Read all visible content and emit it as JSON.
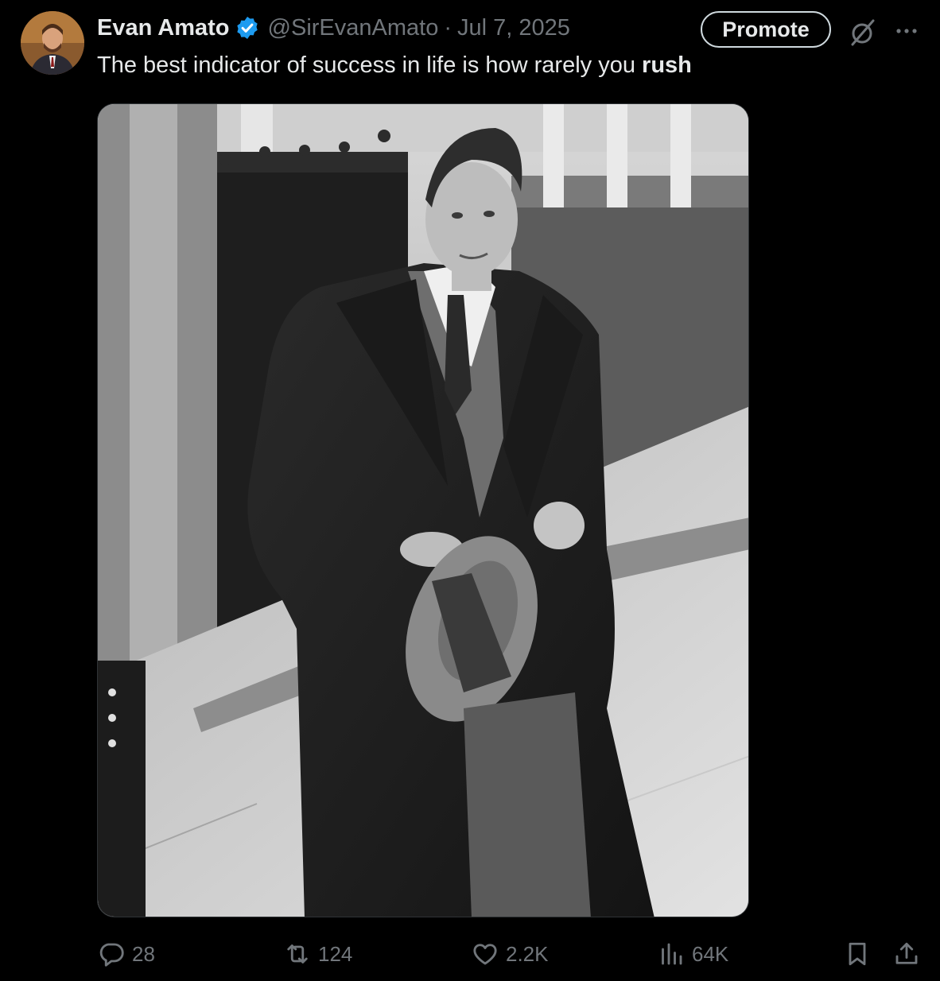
{
  "post": {
    "author_name": "Evan Amato",
    "handle": "@SirEvanAmato",
    "separator": "·",
    "date": "Jul 7, 2025",
    "text_regular": "The best indicator of success in life is how rarely you ",
    "text_bold": "rush",
    "verified": true
  },
  "header": {
    "promote_label": "Promote"
  },
  "actions": {
    "replies": "28",
    "reposts": "124",
    "likes": "2.2K",
    "views": "64K"
  },
  "icons": {
    "verified": "verified-badge-icon",
    "grok": "grok-icon",
    "more": "more-icon",
    "reply": "reply-icon",
    "repost": "repost-icon",
    "like": "heart-icon",
    "views": "views-icon",
    "bookmark": "bookmark-icon",
    "share": "share-icon"
  },
  "colors": {
    "background": "#000000",
    "text": "#e7e9ea",
    "muted": "#71767b",
    "verified": "#1d9bf0"
  }
}
